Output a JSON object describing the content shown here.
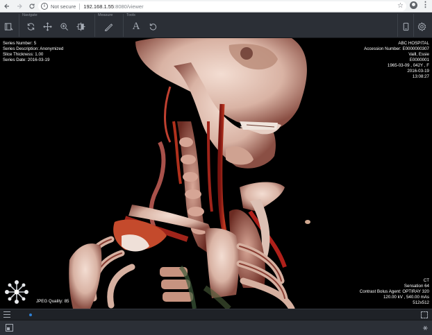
{
  "browser": {
    "back_icon": "arrow-left-icon",
    "forward_icon": "arrow-right-icon",
    "reload_icon": "reload-icon",
    "security_label": "Not secure",
    "url_host": "192.168.1.55",
    "url_rest": ":8080/viewer"
  },
  "toolbar": {
    "groups": {
      "navigate": "Navigate",
      "measure": "Measure",
      "tools": "Tools"
    }
  },
  "overlay": {
    "top_left": [
      "Series Number: 5",
      "Series Description: Anonymized",
      "Slice Thickness: 1.00",
      "Series Date: 2016-03-19"
    ],
    "top_right": [
      "ABC HOSPITAL",
      "Accession Number: E0000000307",
      "Vaill, Essie",
      "E0000001",
      "1965-03-09 , 042Y , F",
      "2016-03-19",
      "13:08:27"
    ],
    "bottom_right": [
      "CT",
      "Sensation 64",
      "Contrast Bolus Agent: OPTIRAY 320",
      "120.00 kV , 540.00 mAs",
      "512x512"
    ],
    "jpeg_quality": "JPEG Quality: 85"
  },
  "colors": {
    "toolbar_bg": "#2b2f36",
    "viewport_bg": "#000000",
    "accent": "#2d7fd3"
  }
}
